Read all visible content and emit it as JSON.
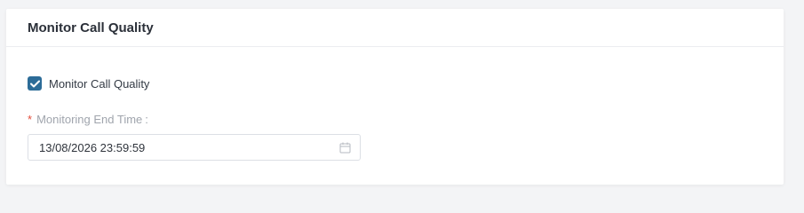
{
  "card": {
    "title": "Monitor Call Quality"
  },
  "monitor_checkbox": {
    "label": "Monitor Call Quality",
    "checked": true
  },
  "end_time": {
    "required_mark": "*",
    "label": "Monitoring End Time",
    "colon": ":",
    "value": "13/08/2026 23:59:59",
    "icon": "calendar-icon"
  },
  "colors": {
    "accent": "#2c6c98",
    "required": "#e34d3b"
  }
}
